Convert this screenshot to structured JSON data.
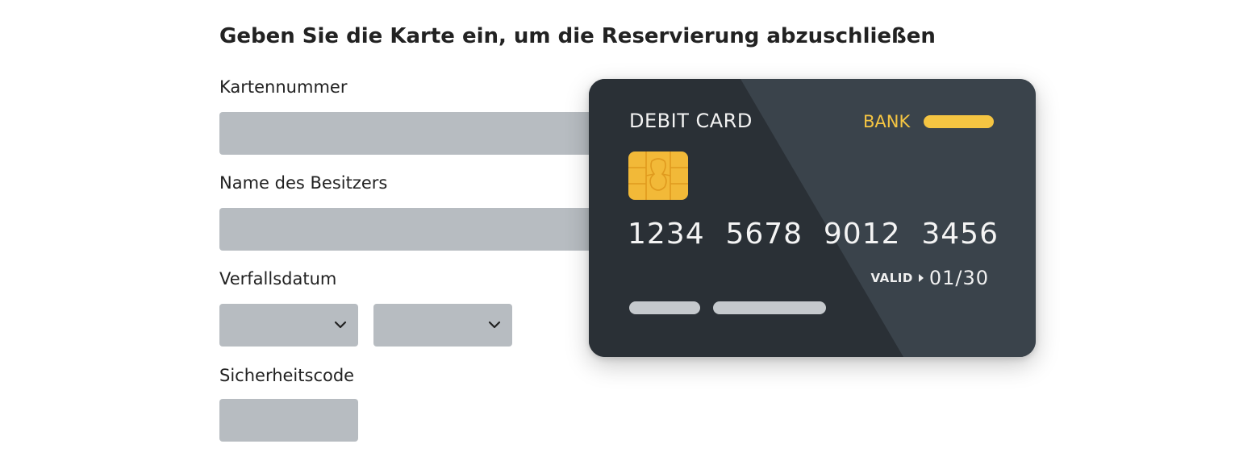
{
  "page": {
    "title": "Geben Sie die Karte ein, um die Reservierung abzuschließen"
  },
  "form": {
    "card_number_label": "Kartennummer",
    "owner_name_label": "Name des Besitzers",
    "expiry_label": "Verfallsdatum",
    "security_code_label": "Sicherheitscode",
    "month_select_value": "",
    "year_select_value": "",
    "card_number_value": "",
    "owner_name_value": "",
    "security_code_value": ""
  },
  "card": {
    "type_label": "DEBIT CARD",
    "bank_label": "BANK",
    "number_groups": [
      "1234",
      "5678",
      "9012",
      "3456"
    ],
    "valid_label": "VALID",
    "valid_date": "01/30"
  },
  "colors": {
    "field_bg": "#b7bcc1",
    "card_light": "#3a434b",
    "card_dark": "#2a3036",
    "accent_yellow": "#f5c542",
    "chip_gold": "#f2b938"
  },
  "icons": {
    "select_indicator": "chevron-down-icon",
    "valid_marker": "triangle-right-icon",
    "chip": "chip-icon"
  }
}
